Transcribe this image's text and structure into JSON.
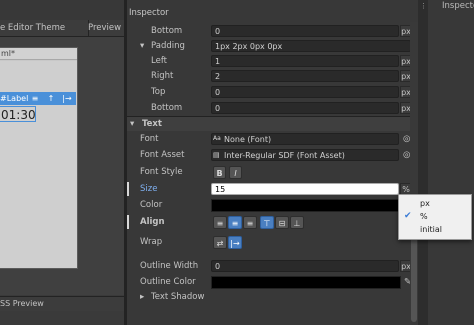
{
  "left_panel": {
    "tabs": [
      "e Editor Theme",
      "Preview"
    ],
    "window_title": "ml*",
    "label_toolbar": {
      "label": "#Label",
      "buttons": [
        "≡",
        "↑",
        "|→"
      ]
    },
    "time_text": "01:30",
    "bottom_label": "SS Preview"
  },
  "inspector": {
    "title": "Inspector",
    "rows": {
      "bottom_top": {
        "label": "Bottom",
        "value": "0",
        "unit": "px"
      },
      "padding": {
        "label": "Padding",
        "value": "1px 2px 0px 0px"
      },
      "left": {
        "label": "Left",
        "value": "1",
        "unit": "px"
      },
      "right": {
        "label": "Right",
        "value": "2",
        "unit": "px"
      },
      "top": {
        "label": "Top",
        "value": "0",
        "unit": "px"
      },
      "bottom": {
        "label": "Bottom",
        "value": "0",
        "unit": "px"
      }
    },
    "text_section": {
      "title": "Text",
      "font": {
        "label": "Font",
        "value": "None (Font)"
      },
      "font_asset": {
        "label": "Font Asset",
        "value": "Inter-Regular SDF (Font Asset)"
      },
      "font_style": {
        "label": "Font Style",
        "bold": "B",
        "italic": "I"
      },
      "size": {
        "label": "Size",
        "value": "15",
        "unit": "%"
      },
      "color": {
        "label": "Color",
        "value": "#000000"
      },
      "align": {
        "label": "Align"
      },
      "wrap": {
        "label": "Wrap"
      },
      "outline_width": {
        "label": "Outline Width",
        "value": "0",
        "unit": "px"
      },
      "outline_color": {
        "label": "Outline Color",
        "value": "#000000"
      },
      "text_shadow": {
        "label": "Text Shadow"
      }
    }
  },
  "unit_dropdown": {
    "options": [
      "px",
      "%",
      "initial"
    ],
    "selected": "%"
  },
  "right_panel": {
    "title": "Inspecto"
  },
  "colors": {
    "accent": "#4a90d9",
    "selected_button": "#4a7fc1"
  }
}
